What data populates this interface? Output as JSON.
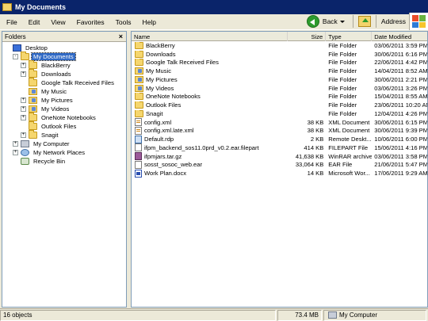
{
  "window": {
    "title": "My Documents"
  },
  "menu": [
    "File",
    "Edit",
    "View",
    "Favorites",
    "Tools",
    "Help"
  ],
  "toolbar": {
    "back_label": "Back",
    "address_label": "Address"
  },
  "folders_pane": {
    "title": "Folders",
    "tree": [
      {
        "label": "Desktop",
        "icon": "desktop-icon",
        "indent": 0,
        "expander": ""
      },
      {
        "label": "My Documents",
        "icon": "folder-icon",
        "indent": 1,
        "expander": "-",
        "selected": true
      },
      {
        "label": "BlackBerry",
        "icon": "folder-icon",
        "indent": 2,
        "expander": "+"
      },
      {
        "label": "Downloads",
        "icon": "folder-icon",
        "indent": 2,
        "expander": "+"
      },
      {
        "label": "Google Talk Received Files",
        "icon": "folder-icon",
        "indent": 2,
        "expander": ""
      },
      {
        "label": "My Music",
        "icon": "music-folder-icon",
        "indent": 2,
        "expander": ""
      },
      {
        "label": "My Pictures",
        "icon": "pictures-folder-icon",
        "indent": 2,
        "expander": "+"
      },
      {
        "label": "My Videos",
        "icon": "videos-folder-icon",
        "indent": 2,
        "expander": "+"
      },
      {
        "label": "OneNote Notebooks",
        "icon": "folder-icon",
        "indent": 2,
        "expander": "+"
      },
      {
        "label": "Outlook Files",
        "icon": "folder-icon",
        "indent": 2,
        "expander": ""
      },
      {
        "label": "Snagit",
        "icon": "folder-icon",
        "indent": 2,
        "expander": "+"
      },
      {
        "label": "My Computer",
        "icon": "computer-icon",
        "indent": 1,
        "expander": "+"
      },
      {
        "label": "My Network Places",
        "icon": "network-icon",
        "indent": 1,
        "expander": "+"
      },
      {
        "label": "Recycle Bin",
        "icon": "recycle-bin-icon",
        "indent": 1,
        "expander": ""
      }
    ]
  },
  "list": {
    "columns": {
      "name": "Name",
      "size": "Size",
      "type": "Type",
      "date": "Date Modified"
    },
    "rows": [
      {
        "name": "BlackBerry",
        "size": "",
        "type": "File Folder",
        "date": "03/06/2011 3:59 PM",
        "icon": "folder-icon"
      },
      {
        "name": "Downloads",
        "size": "",
        "type": "File Folder",
        "date": "30/06/2011 6:16 PM",
        "icon": "folder-icon"
      },
      {
        "name": "Google Talk Received Files",
        "size": "",
        "type": "File Folder",
        "date": "22/06/2011 4:42 PM",
        "icon": "folder-icon"
      },
      {
        "name": "My Music",
        "size": "",
        "type": "File Folder",
        "date": "14/04/2011 8:52 AM",
        "icon": "music-folder-icon"
      },
      {
        "name": "My Pictures",
        "size": "",
        "type": "File Folder",
        "date": "30/06/2011 2:21 PM",
        "icon": "pictures-folder-icon"
      },
      {
        "name": "My Videos",
        "size": "",
        "type": "File Folder",
        "date": "03/06/2011 3:26 PM",
        "icon": "videos-folder-icon"
      },
      {
        "name": "OneNote Notebooks",
        "size": "",
        "type": "File Folder",
        "date": "15/04/2011 8:55 AM",
        "icon": "folder-icon"
      },
      {
        "name": "Outlook Files",
        "size": "",
        "type": "File Folder",
        "date": "23/06/2011 10:20 AM",
        "icon": "folder-icon"
      },
      {
        "name": "Snagit",
        "size": "",
        "type": "File Folder",
        "date": "12/04/2011 4:26 PM",
        "icon": "folder-icon"
      },
      {
        "name": "config.xml",
        "size": "38 KB",
        "type": "XML Document",
        "date": "30/06/2011 6:15 PM",
        "icon": "xml-file-icon"
      },
      {
        "name": "config.xml.late.xml",
        "size": "38 KB",
        "type": "XML Document",
        "date": "30/06/2011 9:39 PM",
        "icon": "xml-file-icon"
      },
      {
        "name": "Default.rdp",
        "size": "2 KB",
        "type": "Remote Deskt...",
        "date": "10/06/2011 6:00 PM",
        "icon": "rdp-file-icon"
      },
      {
        "name": "ifpm_backend_sos11.0prd_v0.2.ear.filepart",
        "size": "414 KB",
        "type": "FILEPART File",
        "date": "15/06/2011 4:16 PM",
        "icon": "file-icon"
      },
      {
        "name": "ifpmjars.tar.gz",
        "size": "41,638 KB",
        "type": "WinRAR archive",
        "date": "03/06/2011 3:58 PM",
        "icon": "archive-file-icon"
      },
      {
        "name": "sosst_sosoc_web.ear",
        "size": "33,064 KB",
        "type": "EAR File",
        "date": "21/06/2011 5:47 PM",
        "icon": "file-icon"
      },
      {
        "name": "Work Plan.docx",
        "size": "14 KB",
        "type": "Microsoft Wor...",
        "date": "17/06/2011 9:29 AM",
        "icon": "word-file-icon"
      }
    ]
  },
  "status": {
    "objects": "16 objects",
    "size": "73.4 MB",
    "zone": "My Computer"
  }
}
